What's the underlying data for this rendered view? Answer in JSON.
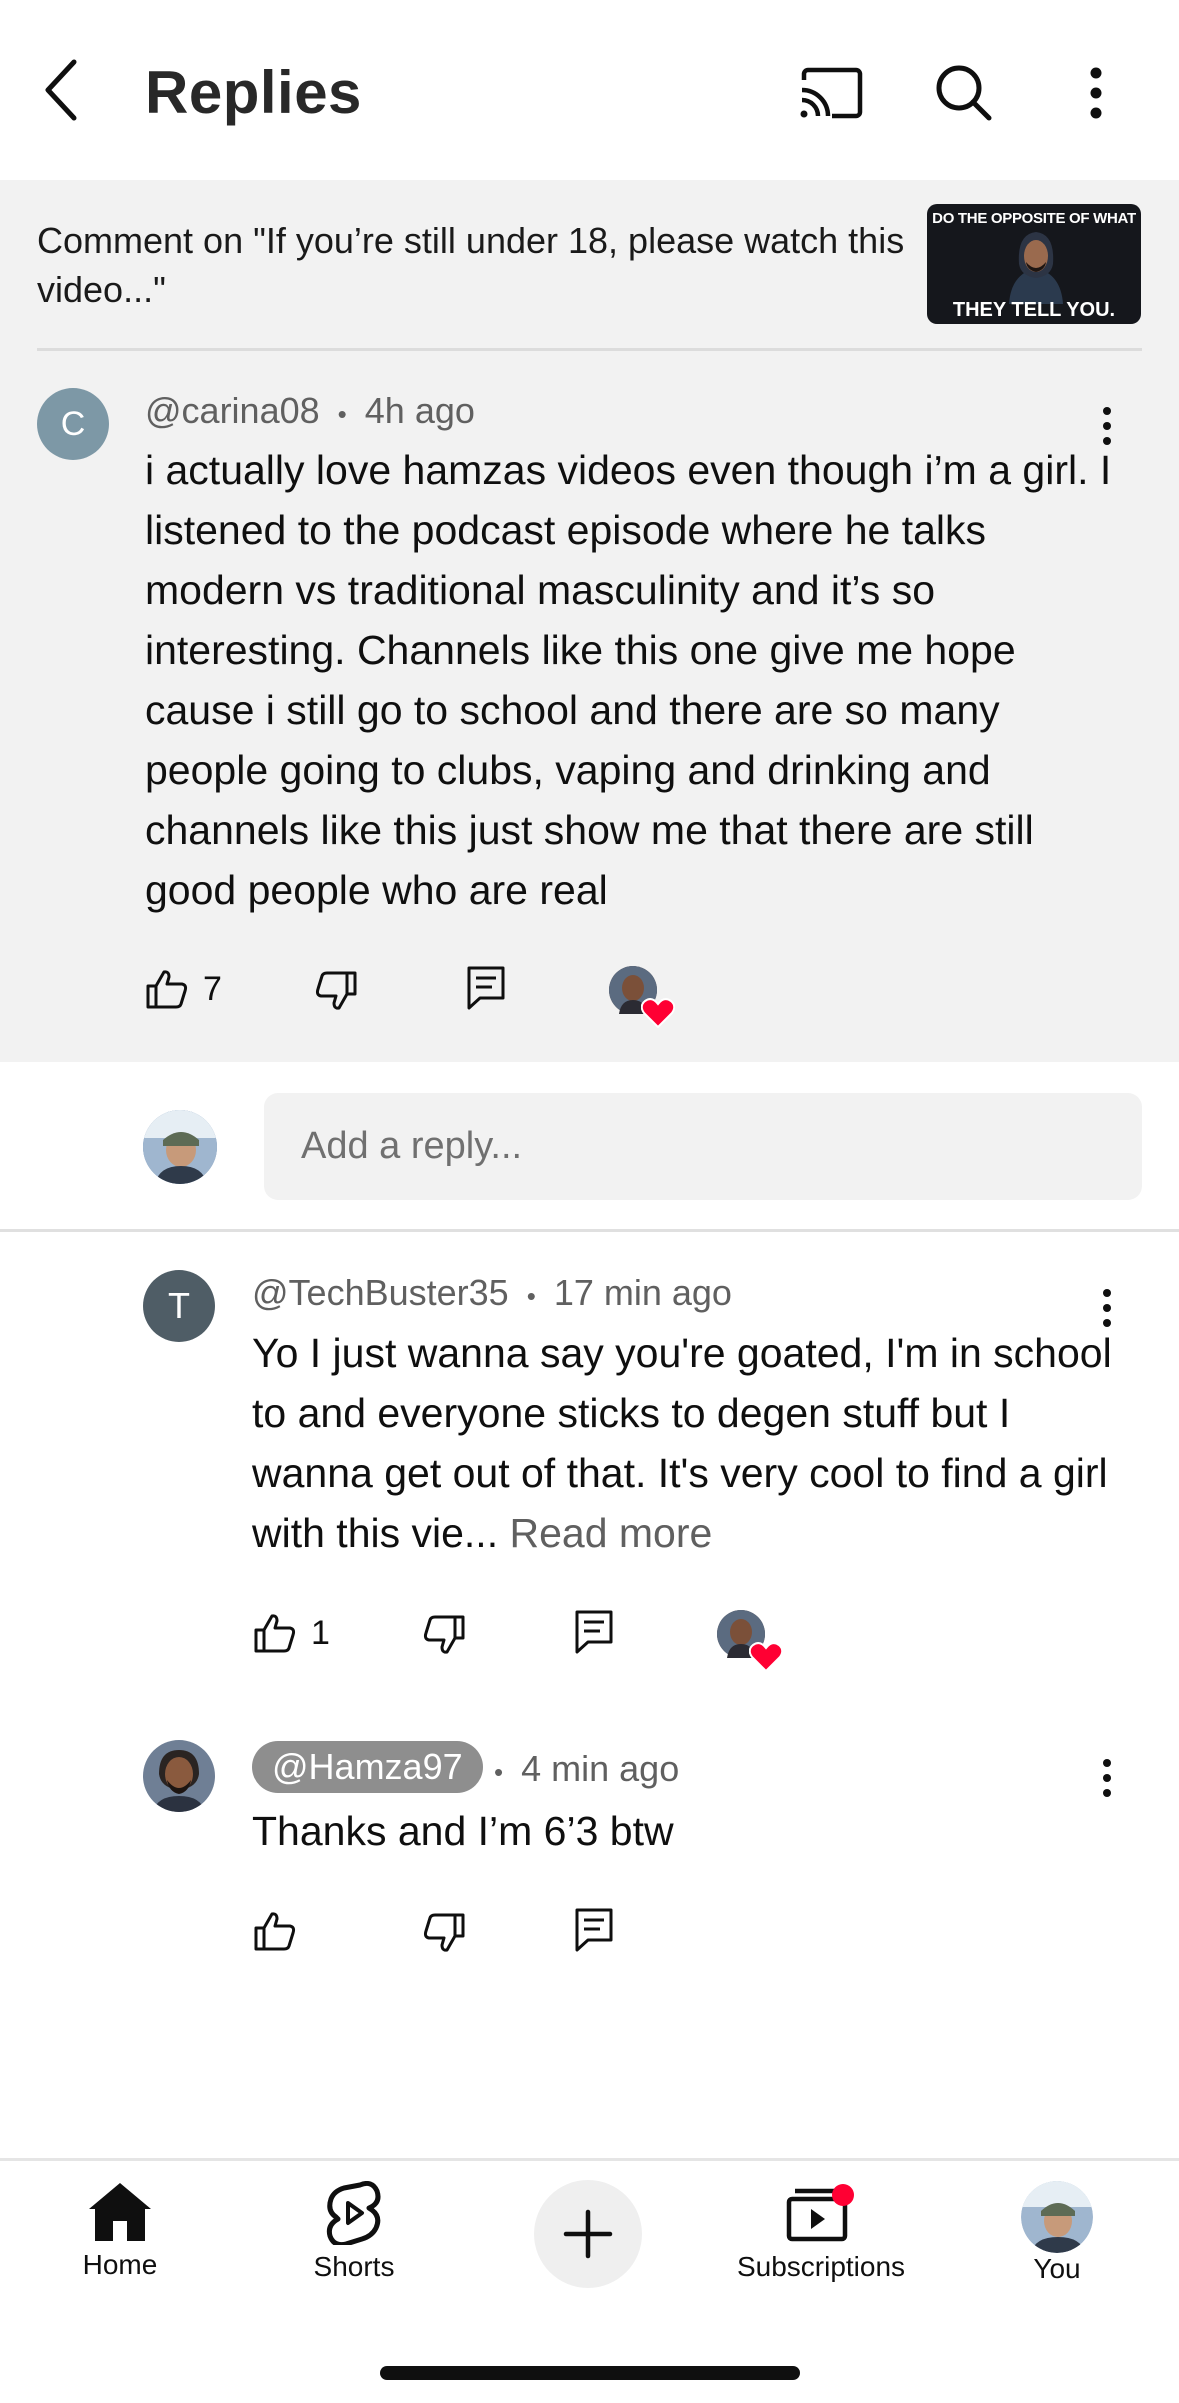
{
  "header": {
    "title": "Replies",
    "back_icon": "back-arrow-icon",
    "cast_icon": "cast-icon",
    "search_icon": "search-icon",
    "more_icon": "more-vert-icon"
  },
  "context": {
    "text": "Comment on \"If you’re still under 18, please watch this video...\"",
    "thumbnail_top": "DO THE OPPOSITE OF WHAT",
    "thumbnail_bottom": "THEY TELL YOU."
  },
  "main_comment": {
    "avatar_letter": "C",
    "author": "@carina08",
    "time": "4h ago",
    "separator": "•",
    "text": "i actually love hamzas videos even though i’m a girl. I listened to the podcast episode where he talks modern vs traditional masculinity and it’s so interesting. Channels like this one give me hope cause i still go to school and there are so many people going to clubs, vaping and drinking and channels like this just show me that there are still good people who are real",
    "likes": "7",
    "hearted": true
  },
  "reply_input": {
    "placeholder": "Add a reply..."
  },
  "replies": [
    {
      "avatar_letter": "T",
      "author": "@TechBuster35",
      "time": "17 min ago",
      "separator": "•",
      "text": "Yo I just wanna say you're goated, I'm in school to and everyone sticks to degen stuff but I wanna get out of that. It's very cool to find a girl with this vie...",
      "read_more": "Read more",
      "likes": "1",
      "hearted": true
    },
    {
      "author": "@Hamza97",
      "time": "4 min ago",
      "separator": "•",
      "text": "Thanks and I’m 6’3 btw",
      "likes": "",
      "hearted": false
    }
  ],
  "bottom_nav": {
    "items": [
      {
        "label": "Home",
        "icon": "home-icon"
      },
      {
        "label": "Shorts",
        "icon": "shorts-icon"
      },
      {
        "label": "",
        "icon": "create-plus-icon"
      },
      {
        "label": "Subscriptions",
        "icon": "subscriptions-icon"
      },
      {
        "label": "You",
        "icon": "profile-avatar-icon"
      }
    ]
  },
  "colors": {
    "heart": "#ff0033",
    "context_bg": "#f2f2f2",
    "avatar_c": "#7d98a6",
    "avatar_t": "#4f5d66"
  }
}
